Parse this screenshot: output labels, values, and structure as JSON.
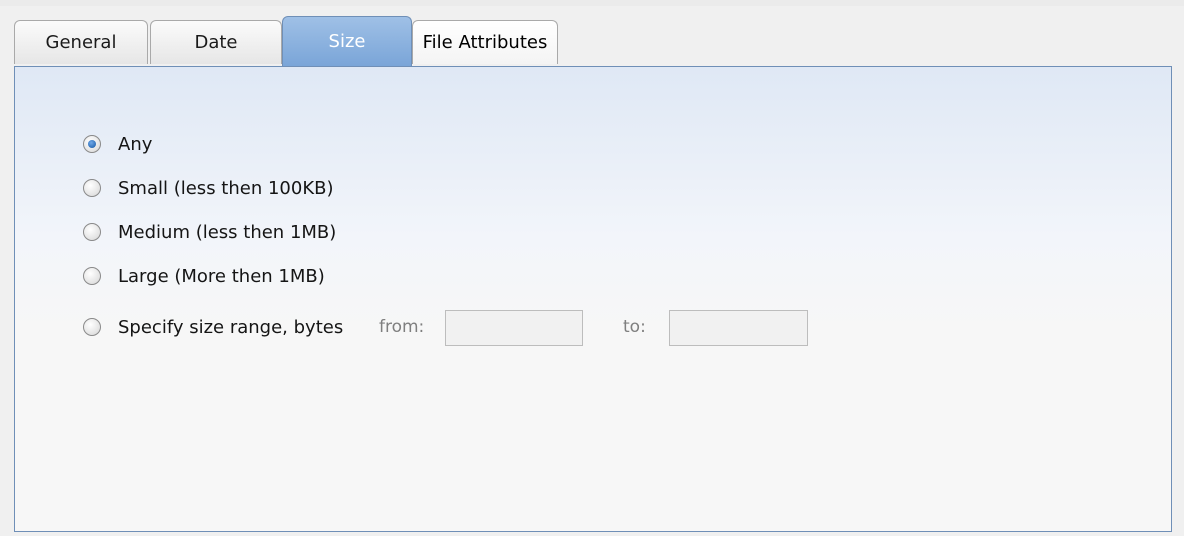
{
  "tabs": [
    {
      "label": "General"
    },
    {
      "label": "Date"
    },
    {
      "label": "Size"
    },
    {
      "label": "File Attributes"
    }
  ],
  "active_tab": "Size",
  "size_options": [
    {
      "label": "Any",
      "checked": true
    },
    {
      "label": "Small (less then 100KB)",
      "checked": false
    },
    {
      "label": "Medium (less then 1MB)",
      "checked": false
    },
    {
      "label": "Large (More then 1MB)",
      "checked": false
    },
    {
      "label": "Specify size range, bytes",
      "checked": false
    }
  ],
  "range": {
    "from_label": "from:",
    "from_value": "",
    "to_label": "to:",
    "to_value": ""
  },
  "colors": {
    "active_tab": "#8fb3e0",
    "panel_border": "#6f8fb7",
    "radio_selected": "#2f6fb8"
  }
}
